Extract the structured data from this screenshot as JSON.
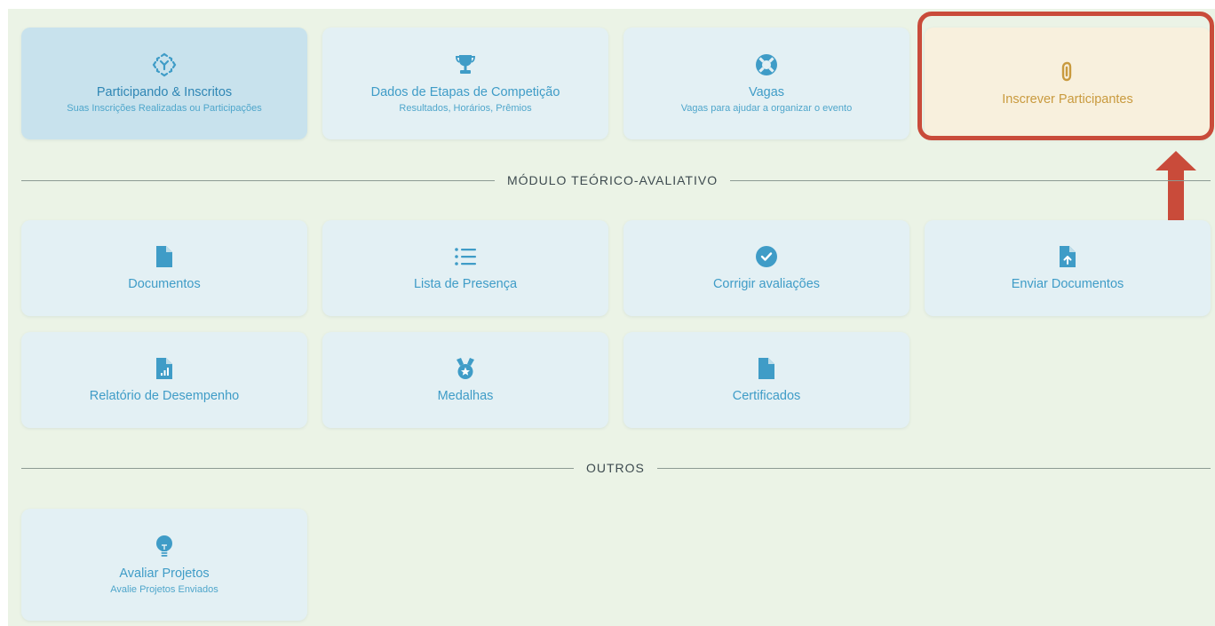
{
  "colors": {
    "background": "#ebf3e6",
    "card": "#e3f0f4",
    "card_active": "#c8e2ed",
    "card_highlight": "#f8f0dd",
    "accent": "#3f9cc7",
    "annotation": "#c94b3a"
  },
  "top_cards": [
    {
      "title": "Participando & Inscritos",
      "subtitle": "Suas Inscrições Realizadas ou Participações",
      "icon": "focus-frame-icon"
    },
    {
      "title": "Dados de Etapas de Competição",
      "subtitle": "Resultados, Horários, Prêmios",
      "icon": "trophy-icon"
    },
    {
      "title": "Vagas",
      "subtitle": "Vagas para ajudar a organizar o evento",
      "icon": "life-ring-icon"
    },
    {
      "title": "Inscrever Participantes",
      "icon": "paperclip-icon"
    }
  ],
  "sections": {
    "teorico": "MÓDULO TEÓRICO-AVALIATIVO",
    "outros": "OUTROS"
  },
  "teorico_cards": [
    {
      "title": "Documentos",
      "icon": "file-icon"
    },
    {
      "title": "Lista de Presença",
      "icon": "list-icon"
    },
    {
      "title": "Corrigir avaliações",
      "icon": "check-circle-icon"
    },
    {
      "title": "Enviar Documentos",
      "icon": "file-upload-icon"
    },
    {
      "title": "Relatório de Desempenho",
      "icon": "file-chart-icon"
    },
    {
      "title": "Medalhas",
      "icon": "medal-icon"
    },
    {
      "title": "Certificados",
      "icon": "file-icon"
    }
  ],
  "outros_cards": [
    {
      "title": "Avaliar Projetos",
      "subtitle": "Avalie Projetos Enviados",
      "icon": "lightbulb-icon"
    }
  ]
}
